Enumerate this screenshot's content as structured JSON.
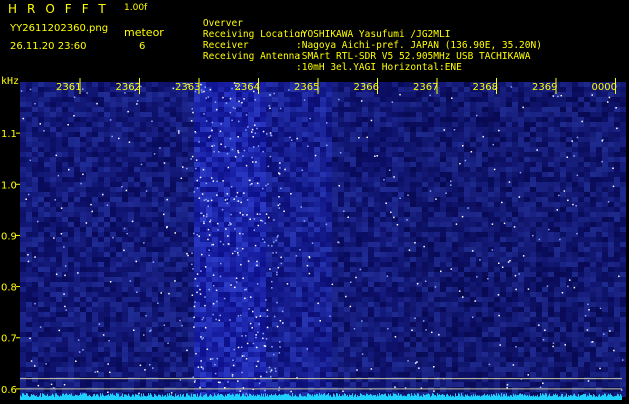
{
  "header": {
    "app_name": "HROFFT",
    "version": "1.00f",
    "filename": "YY2611202360.png",
    "datetime": "26.11.20 23:60",
    "meteor_label": "meteor",
    "meteor_count": "6",
    "info": [
      {
        "label": "Overver",
        "value": ":YOSHIKAWA Yasufumi /JG2MLI"
      },
      {
        "label": "Receiving Location",
        "value": ":Nagoya Aichi-pref. JAPAN (136.90E, 35.20N)"
      },
      {
        "label": "Receiver",
        "value": ":SMArt RTL-SDR V5 52.905MHz USB TACHIKAWA"
      },
      {
        "label": "Receiving Antenna",
        "value": ":10mH 3el.YAGI Horizontal:ENE"
      }
    ]
  },
  "chart_data": {
    "type": "heatmap",
    "ylabel": "kHz",
    "x_ticks": [
      "2361",
      "2362",
      "2363",
      "2364",
      "2365",
      "2366",
      "2367",
      "2368",
      "2369",
      "0000"
    ],
    "y_ticks": [
      "1.1",
      "1.0",
      "0.9",
      "0.8",
      "0.7",
      "0.6"
    ],
    "ylim": [
      0.59,
      1.2
    ],
    "grid": false,
    "reference_lines_khz": [
      0.62,
      0.6
    ],
    "colors": {
      "background": "#00001a",
      "signal": "#2a3cff",
      "hot": "#ffffff",
      "axis_text": "#ffff00",
      "noise_floor": "#1fd0ff"
    }
  }
}
